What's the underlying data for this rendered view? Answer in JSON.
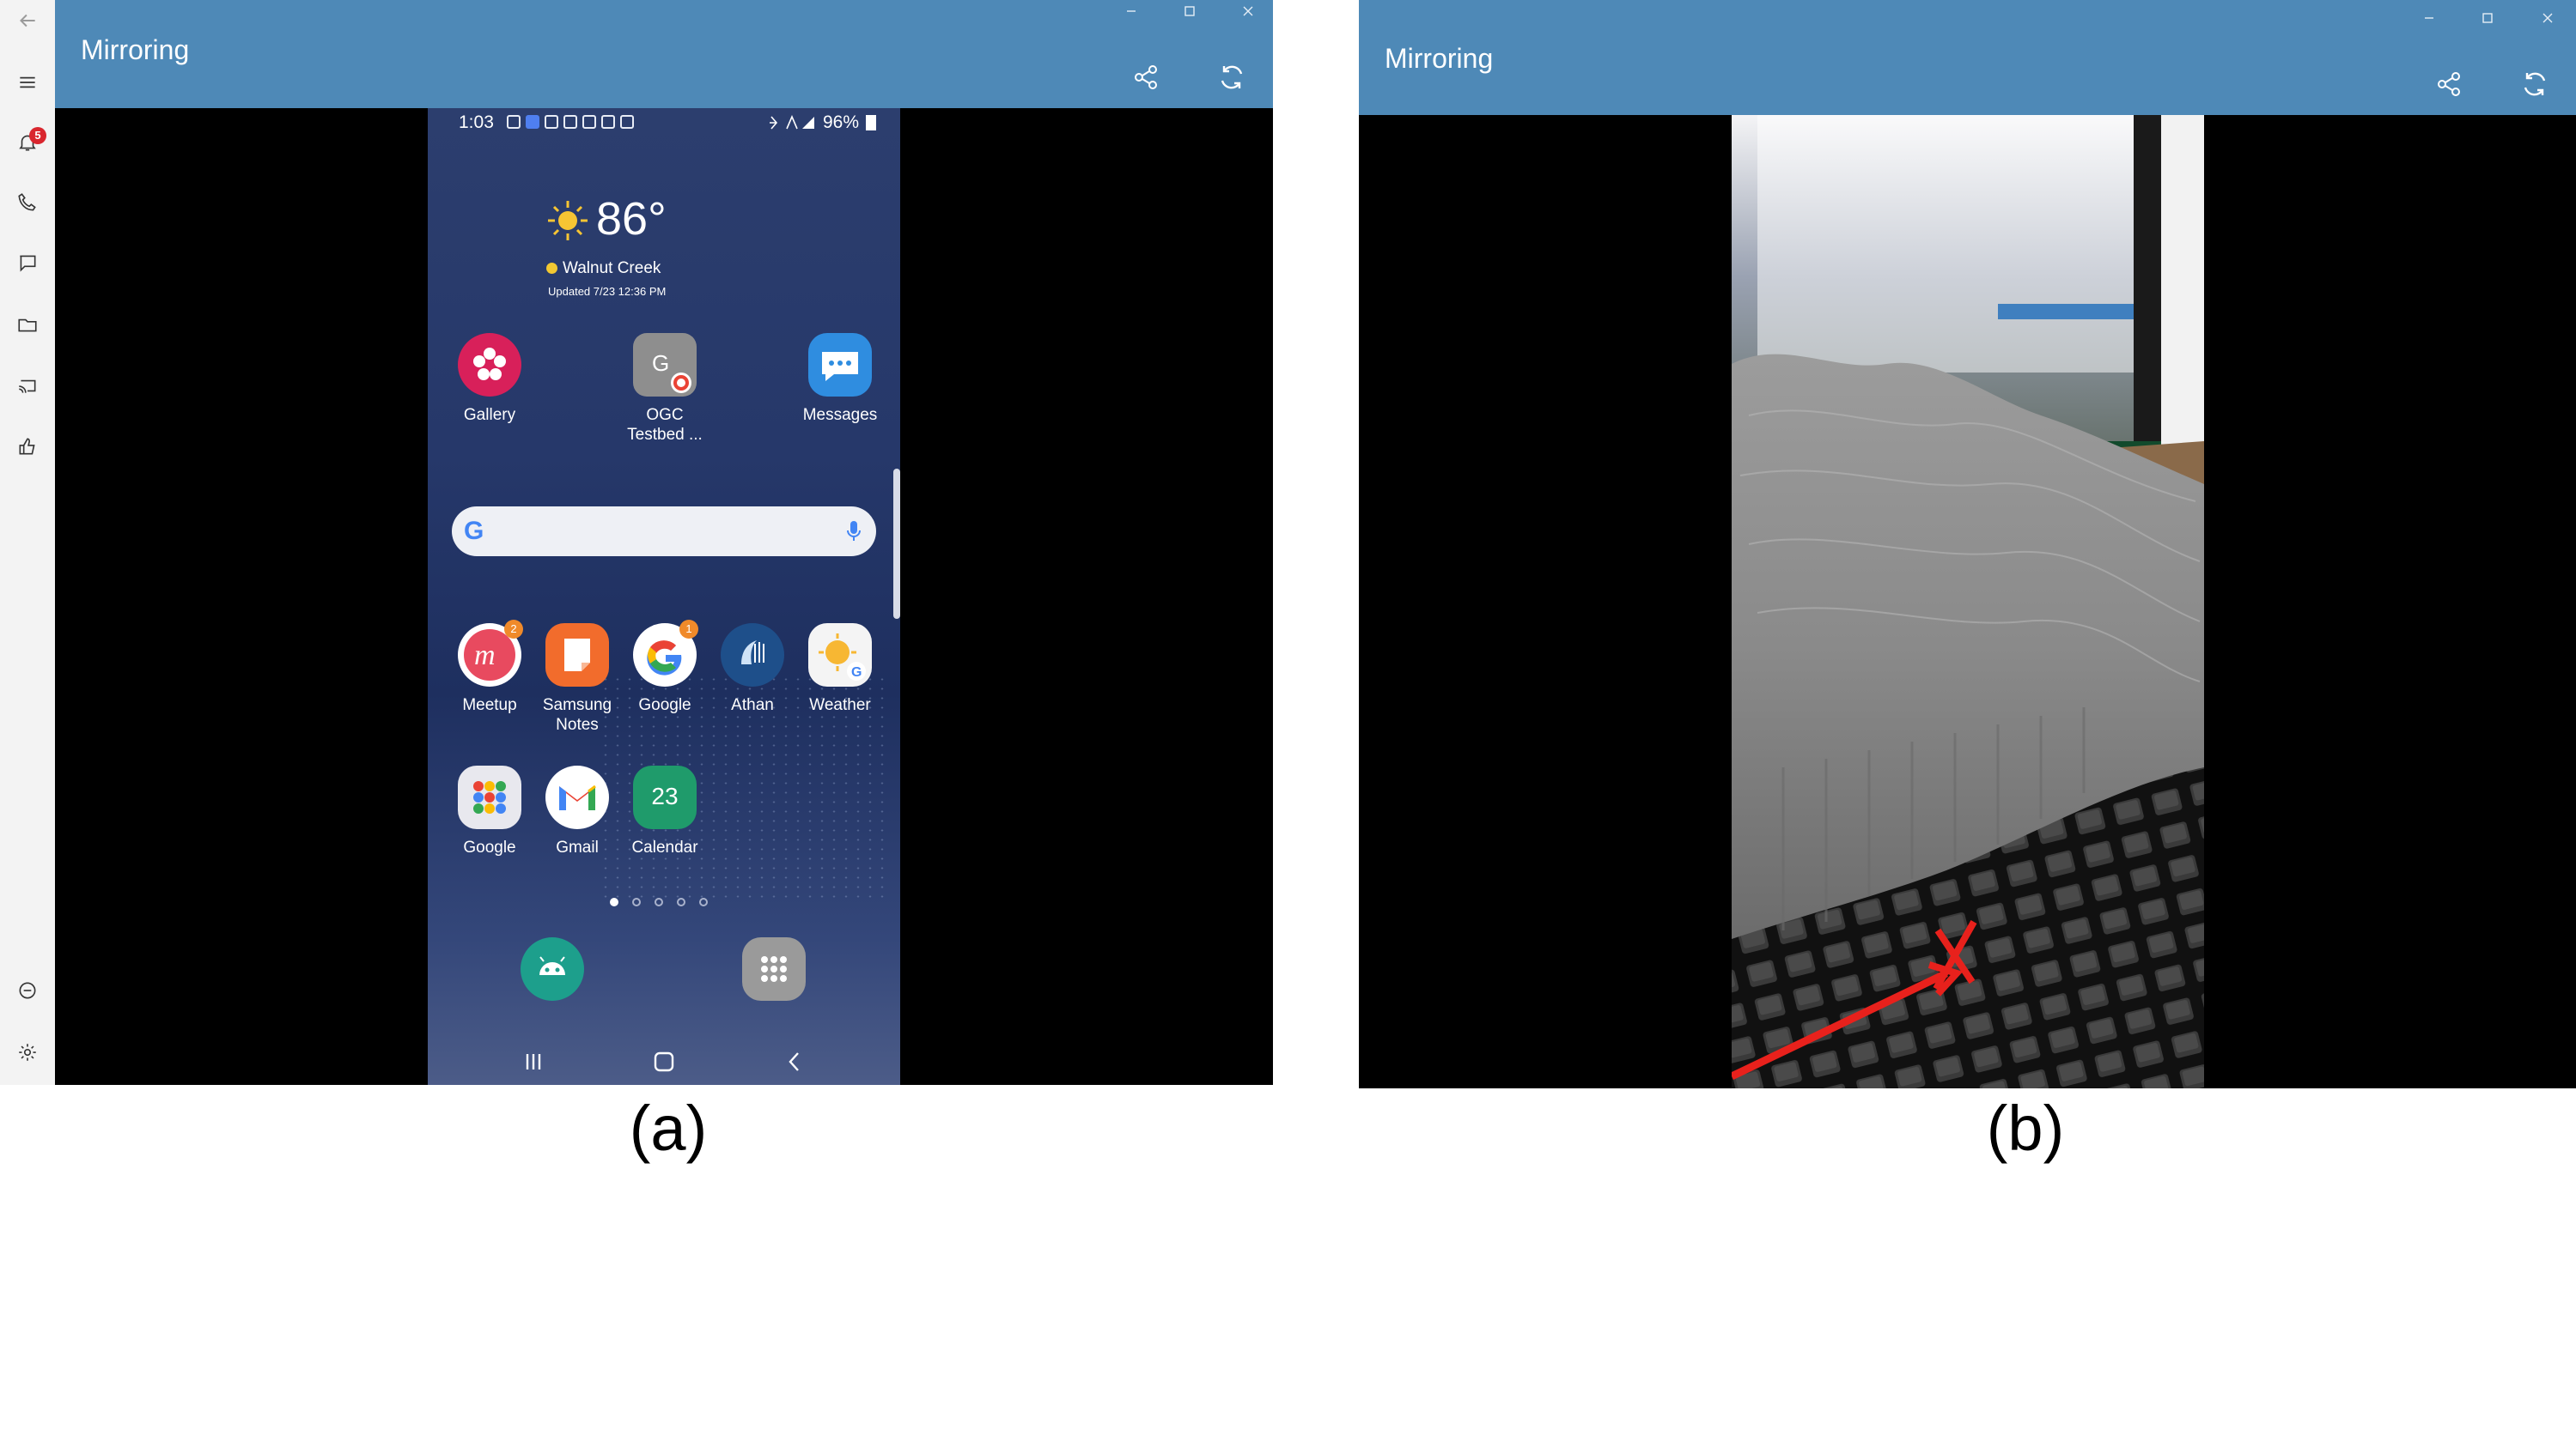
{
  "panels": [
    {
      "window_title": "Mirroring",
      "caption": "(a)",
      "notification_count": "5",
      "status_bar": {
        "time": "1:03",
        "battery": "96%"
      },
      "weather_widget": {
        "temperature": "86°",
        "location": "Walnut Creek",
        "updated": "Updated 7/23 12:36 PM"
      },
      "apps_row1": [
        {
          "label": "Gallery",
          "icon": "gallery-icon",
          "color": "#d8205a"
        },
        {
          "label": "OGC Testbed ...",
          "icon": "ogc-testbed-icon",
          "color": "#8e8e8e"
        },
        {
          "label": "Messages",
          "icon": "messages-icon",
          "color": "#2f8de0"
        }
      ],
      "apps_row2": [
        {
          "label": "Meetup",
          "icon": "meetup-icon",
          "color": "#e84a5f",
          "badge": "2"
        },
        {
          "label": "Samsung Notes",
          "icon": "samsung-notes-icon",
          "color": "#f26c2c"
        },
        {
          "label": "Google",
          "icon": "google-icon",
          "color": "#ffffff",
          "badge": "1"
        },
        {
          "label": "Athan",
          "icon": "athan-icon",
          "color": "#1e4f8a"
        },
        {
          "label": "Weather",
          "icon": "weather-app-icon",
          "color": "#f4f4f4"
        }
      ],
      "apps_row3": [
        {
          "label": "Google",
          "icon": "google-folder-icon",
          "color": "#e8e8ee"
        },
        {
          "label": "Gmail",
          "icon": "gmail-icon",
          "color": "#ffffff"
        },
        {
          "label": "Calendar",
          "icon": "calendar-icon",
          "color": "#1f9b6b",
          "day": "23"
        }
      ],
      "search_bar_letter": "G",
      "page_indicator": {
        "pages": 5,
        "current": 1
      },
      "dock": [
        {
          "icon": "android-icon",
          "color": "#1d9f8c"
        },
        {
          "icon": "app-drawer-icon",
          "color": "#9a9a9a"
        }
      ],
      "sidebar_icons": [
        "back-icon",
        "menu-icon",
        "notifications-icon",
        "calls-icon",
        "messages-icon",
        "files-icon",
        "mirroring-icon",
        "feedback-icon",
        "minimize-icon",
        "settings-icon"
      ],
      "colors": {
        "titlebar": "#4e89b7",
        "viewport": "#000000"
      }
    },
    {
      "window_title": "Mirroring",
      "caption": "(b)",
      "colors": {
        "titlebar": "#4e89b7",
        "viewport": "#000000",
        "annotation": "#e8211c"
      }
    }
  ]
}
